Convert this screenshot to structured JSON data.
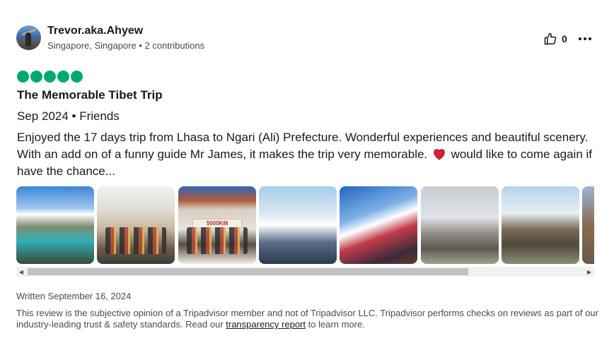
{
  "reviewer": {
    "name": "Trevor.aka.Ahyew",
    "location": "Singapore, Singapore",
    "separator": " • ",
    "contributions": "2 contributions",
    "avatar_icon": "user-avatar-photo"
  },
  "actions": {
    "like_icon": "thumbs-up-icon",
    "like_count": "0",
    "more_icon": "more-options-icon"
  },
  "review": {
    "rating": 5,
    "rating_max": 5,
    "rating_color": "#00aa6c",
    "title": "The Memorable Tibet Trip",
    "trip_info": "Sep 2024 • Friends",
    "text_before_emoji": "Enjoyed the 17 days trip from Lhasa to Ngari (Ali) Prefecture. Wonderful experiences and beautiful scenery. With an add on of a funny guide Mr James, it makes the trip very memorable.",
    "emoji": "red-heart-icon",
    "text_after_emoji": "would like to come again if have the chance..."
  },
  "gallery": {
    "photos": [
      {
        "sign": ""
      },
      {
        "sign": ""
      },
      {
        "sign": "5000KM"
      },
      {
        "sign": ""
      },
      {
        "sign": ""
      },
      {
        "sign": ""
      },
      {
        "sign": ""
      },
      {
        "sign": ""
      }
    ],
    "scroll_position": 0
  },
  "footer": {
    "written": "Written September 16, 2024",
    "disclaimer_before_link": "This review is the subjective opinion of a Tripadvisor member and not of Tripadvisor LLC. Tripadvisor performs checks on reviews as part of our industry-leading trust & safety standards. Read our ",
    "link_text": "transparency report",
    "disclaimer_after_link": " to learn more."
  }
}
